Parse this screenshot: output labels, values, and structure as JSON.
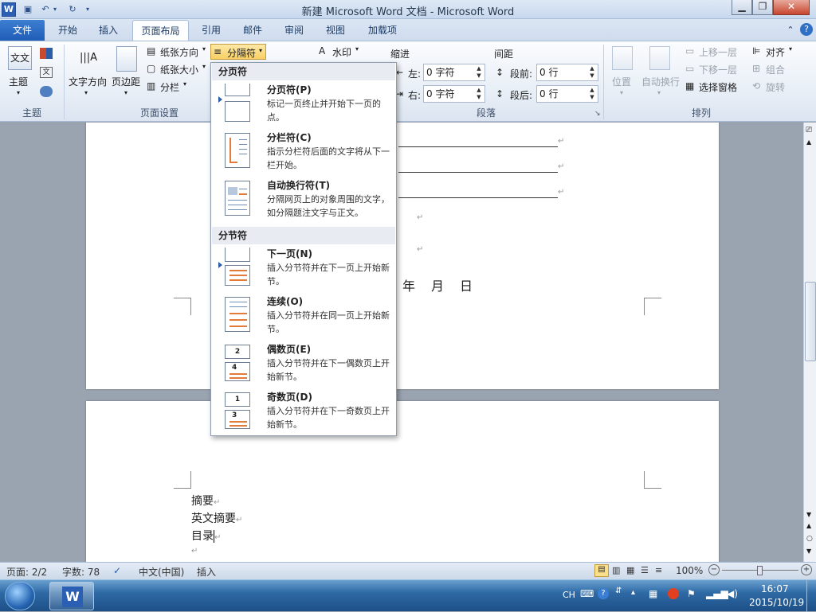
{
  "window": {
    "title": "新建 Microsoft Word 文档 - Microsoft Word"
  },
  "tabs": [
    "文件",
    "开始",
    "插入",
    "页面布局",
    "引用",
    "邮件",
    "审阅",
    "视图",
    "加载项"
  ],
  "ribbon": {
    "theme_group": {
      "label": "主题",
      "button": "主题"
    },
    "page_setup_group": {
      "label": "页面设置",
      "text_direction": "文字方向",
      "margins": "页边距",
      "orientation": "纸张方向",
      "size": "纸张大小",
      "columns": "分栏",
      "breaks": "分隔符"
    },
    "background": {
      "watermark": "水印"
    },
    "paragraph_group": {
      "label": "段落",
      "indent": "缩进",
      "spacing": "间距",
      "left_label": "左:",
      "left_value": "0 字符",
      "right_label": "右:",
      "right_value": "0 字符",
      "before_label": "段前:",
      "before_value": "0 行",
      "after_label": "段后:",
      "after_value": "0 行"
    },
    "arrange_group": {
      "label": "排列",
      "position": "位置",
      "wrap": "自动换行",
      "bring_forward": "上移一层",
      "send_backward": "下移一层",
      "selection_pane": "选择窗格",
      "align": "对齐",
      "group": "组合",
      "rotate": "旋转"
    }
  },
  "breaks_menu": {
    "page_breaks_header": "分页符",
    "section_breaks_header": "分节符",
    "items": [
      {
        "title": "分页符(P)",
        "desc": "标记一页终止并开始下一页的点。"
      },
      {
        "title": "分栏符(C)",
        "desc": "指示分栏符后面的文字将从下一栏开始。"
      },
      {
        "title": "自动换行符(T)",
        "desc": "分隔网页上的对象周围的文字，如分隔题注文字与正文。"
      },
      {
        "title": "下一页(N)",
        "desc": "插入分节符并在下一页上开始新节。"
      },
      {
        "title": "连续(O)",
        "desc": "插入分节符并在同一页上开始新节。"
      },
      {
        "title": "偶数页(E)",
        "desc": "插入分节符并在下一偶数页上开始新节。"
      },
      {
        "title": "奇数页(D)",
        "desc": "插入分节符并在下一奇数页上开始新节。"
      }
    ]
  },
  "document": {
    "date_line": "年　月　日",
    "lines": [
      "摘要",
      "英文摘要",
      "目录"
    ]
  },
  "status": {
    "page": "页面: 2/2",
    "words": "字数: 78",
    "language": "中文(中国)",
    "mode": "插入",
    "zoom": "100%"
  },
  "taskbar": {
    "lang": "CH",
    "time": "16:07",
    "date": "2015/10/19"
  }
}
